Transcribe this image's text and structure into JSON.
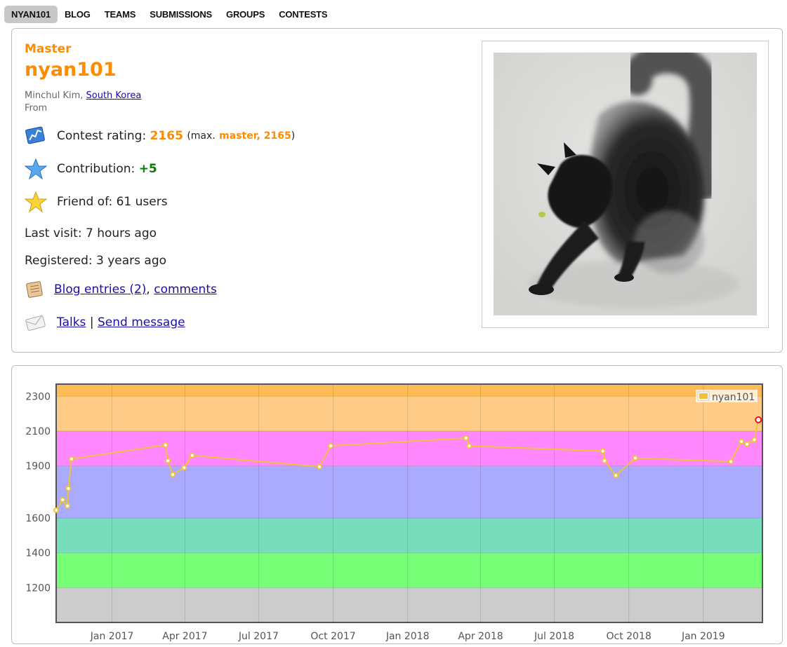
{
  "nav": [
    {
      "label": "NYAN101",
      "active": true
    },
    {
      "label": "BLOG",
      "active": false
    },
    {
      "label": "TEAMS",
      "active": false
    },
    {
      "label": "SUBMISSIONS",
      "active": false
    },
    {
      "label": "GROUPS",
      "active": false
    },
    {
      "label": "CONTESTS",
      "active": false
    }
  ],
  "profile": {
    "rank": "Master",
    "handle": "nyan101",
    "real_name": "Minchul Kim,",
    "country": "South Korea",
    "from_label": "From",
    "contest_rating_label": "Contest rating:",
    "contest_rating": "2165",
    "max_open": "(max.",
    "max_value": "master, 2165",
    "max_close": ")",
    "contribution_label": "Contribution:",
    "contribution": "+5",
    "friend_of": "Friend of: 61 users",
    "last_visit": "Last visit: 7 hours ago",
    "registered": "Registered: 3 years ago",
    "blog_entries": "Blog entries (2)",
    "comma": ",",
    "comments": "comments",
    "talks": "Talks",
    "separator": "|",
    "send_message": "Send message"
  },
  "icons": {
    "rating": "chart-icon",
    "contribution": "star-blue-icon",
    "friend": "star-gold-icon",
    "blog": "blog-icon",
    "talks": "envelope-icon"
  },
  "chart_data": {
    "type": "line",
    "ytick_labels": [
      "2300",
      "2100",
      "1900",
      "1600",
      "1400",
      "1200"
    ],
    "xtick_labels": [
      "Jan 2017",
      "Apr 2017",
      "Jul 2017",
      "Oct 2017",
      "Jan 2018",
      "Apr 2018",
      "Jul 2018",
      "Oct 2018",
      "Jan 2019"
    ],
    "x_range": [
      "2016-10-24",
      "2019-03-15"
    ],
    "y_range": [
      1000,
      2370
    ],
    "bands": [
      {
        "from": 0,
        "to": 1200,
        "color": "#cccccc"
      },
      {
        "from": 1200,
        "to": 1400,
        "color": "#77ff77"
      },
      {
        "from": 1400,
        "to": 1600,
        "color": "#77ddbb"
      },
      {
        "from": 1600,
        "to": 1900,
        "color": "#aaaaff"
      },
      {
        "from": 1900,
        "to": 2100,
        "color": "#ff88ff"
      },
      {
        "from": 2100,
        "to": 2300,
        "color": "#ffcc88"
      },
      {
        "from": 2300,
        "to": 2400,
        "color": "#ffbb55"
      }
    ],
    "series": [
      {
        "name": "nyan101",
        "color": "#edc240",
        "points": [
          {
            "x": "2016-10-24",
            "y": 1645
          },
          {
            "x": "2016-11-01",
            "y": 1705
          },
          {
            "x": "2016-11-07",
            "y": 1670
          },
          {
            "x": "2016-11-08",
            "y": 1770
          },
          {
            "x": "2016-11-12",
            "y": 1940
          },
          {
            "x": "2017-03-08",
            "y": 2020
          },
          {
            "x": "2017-03-11",
            "y": 1930
          },
          {
            "x": "2017-03-17",
            "y": 1850
          },
          {
            "x": "2017-03-31",
            "y": 1890
          },
          {
            "x": "2017-04-10",
            "y": 1960
          },
          {
            "x": "2017-09-14",
            "y": 1895
          },
          {
            "x": "2017-09-28",
            "y": 2015
          },
          {
            "x": "2018-03-14",
            "y": 2060
          },
          {
            "x": "2018-03-18",
            "y": 2015
          },
          {
            "x": "2018-08-30",
            "y": 1985
          },
          {
            "x": "2018-09-01",
            "y": 1930
          },
          {
            "x": "2018-09-15",
            "y": 1845
          },
          {
            "x": "2018-10-09",
            "y": 1945
          },
          {
            "x": "2019-02-04",
            "y": 1925
          },
          {
            "x": "2019-02-17",
            "y": 2040
          },
          {
            "x": "2019-02-24",
            "y": 2025
          },
          {
            "x": "2019-03-05",
            "y": 2050
          },
          {
            "x": "2019-03-10",
            "y": 2165
          }
        ]
      }
    ],
    "legend_position": "top-right",
    "grid": true
  }
}
